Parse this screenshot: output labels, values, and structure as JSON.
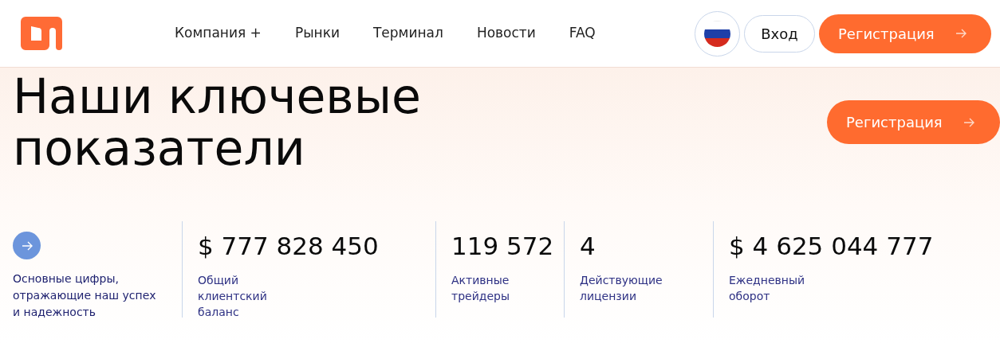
{
  "header": {
    "nav": [
      {
        "label": "Компания +"
      },
      {
        "label": "Рынки"
      },
      {
        "label": "Терминал"
      },
      {
        "label": "Новости"
      },
      {
        "label": "FAQ"
      }
    ],
    "login": "Вход",
    "register": "Регистрация"
  },
  "hero": {
    "title_lines": [
      "Наши ключевые",
      "показатели"
    ],
    "register": "Регистрация"
  },
  "stats": {
    "intro": [
      "Основные цифры,",
      "отражающие наш успех",
      "и надежность"
    ],
    "items": [
      {
        "value": "$ 777 828 450",
        "label": [
          "Общий",
          "клиентский",
          "баланс"
        ]
      },
      {
        "value": "119 572",
        "label": [
          "Активные",
          "трейдеры"
        ]
      },
      {
        "value": "4",
        "label": [
          "Действующие",
          "лицензии"
        ]
      },
      {
        "value": "$ 4 625 044 777",
        "label": [
          "Ежедневный",
          "оборот"
        ]
      }
    ]
  }
}
